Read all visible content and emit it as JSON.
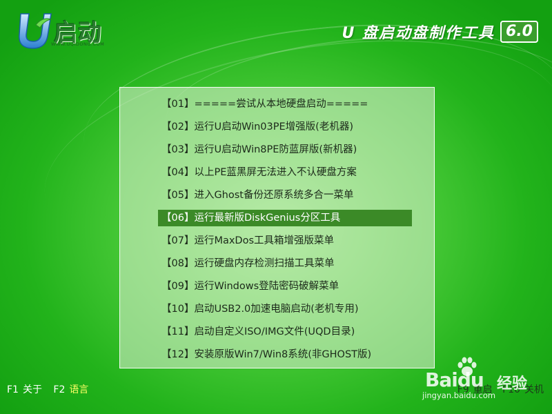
{
  "logo": {
    "text": "启动",
    "url": "WWW.UQIDONG.COM"
  },
  "header": {
    "title": "U 盘启动盘制作工具",
    "version": "6.0"
  },
  "menu": {
    "selected_index": 5,
    "items": [
      {
        "label": "【01】=====尝试从本地硬盘启动====="
      },
      {
        "label": "【02】运行U启动Win03PE增强版(老机器)"
      },
      {
        "label": "【03】运行U启动Win8PE防蓝屏版(新机器)"
      },
      {
        "label": "【04】以上PE蓝黑屏无法进入不认硬盘方案"
      },
      {
        "label": "【05】进入Ghost备份还原系统多合一菜单"
      },
      {
        "label": "【06】运行最新版DiskGenius分区工具"
      },
      {
        "label": "【07】运行MaxDos工具箱增强版菜单"
      },
      {
        "label": "【08】运行硬盘内存检测扫描工具菜单"
      },
      {
        "label": "【09】运行Windows登陆密码破解菜单"
      },
      {
        "label": "【10】启动USB2.0加速电脑启动(老机专用)"
      },
      {
        "label": "【11】启动自定义ISO/IMG文件(UQD目录)"
      },
      {
        "label": "【12】安装原版Win7/Win8系统(非GHOST版)"
      }
    ]
  },
  "footer": {
    "left": [
      {
        "key": "F1",
        "label": "关于"
      },
      {
        "key": "F2",
        "label": "语言"
      }
    ],
    "right": [
      {
        "key": "F9",
        "label": "重启"
      },
      {
        "key": "F10",
        "label": "关机"
      }
    ]
  },
  "watermark": {
    "brand": "Baidu",
    "sub": "经验",
    "url": "jingyan.baidu.com"
  },
  "colors": {
    "selected_bg": "#3b8a27",
    "active_hotkey": "#ffff66"
  }
}
